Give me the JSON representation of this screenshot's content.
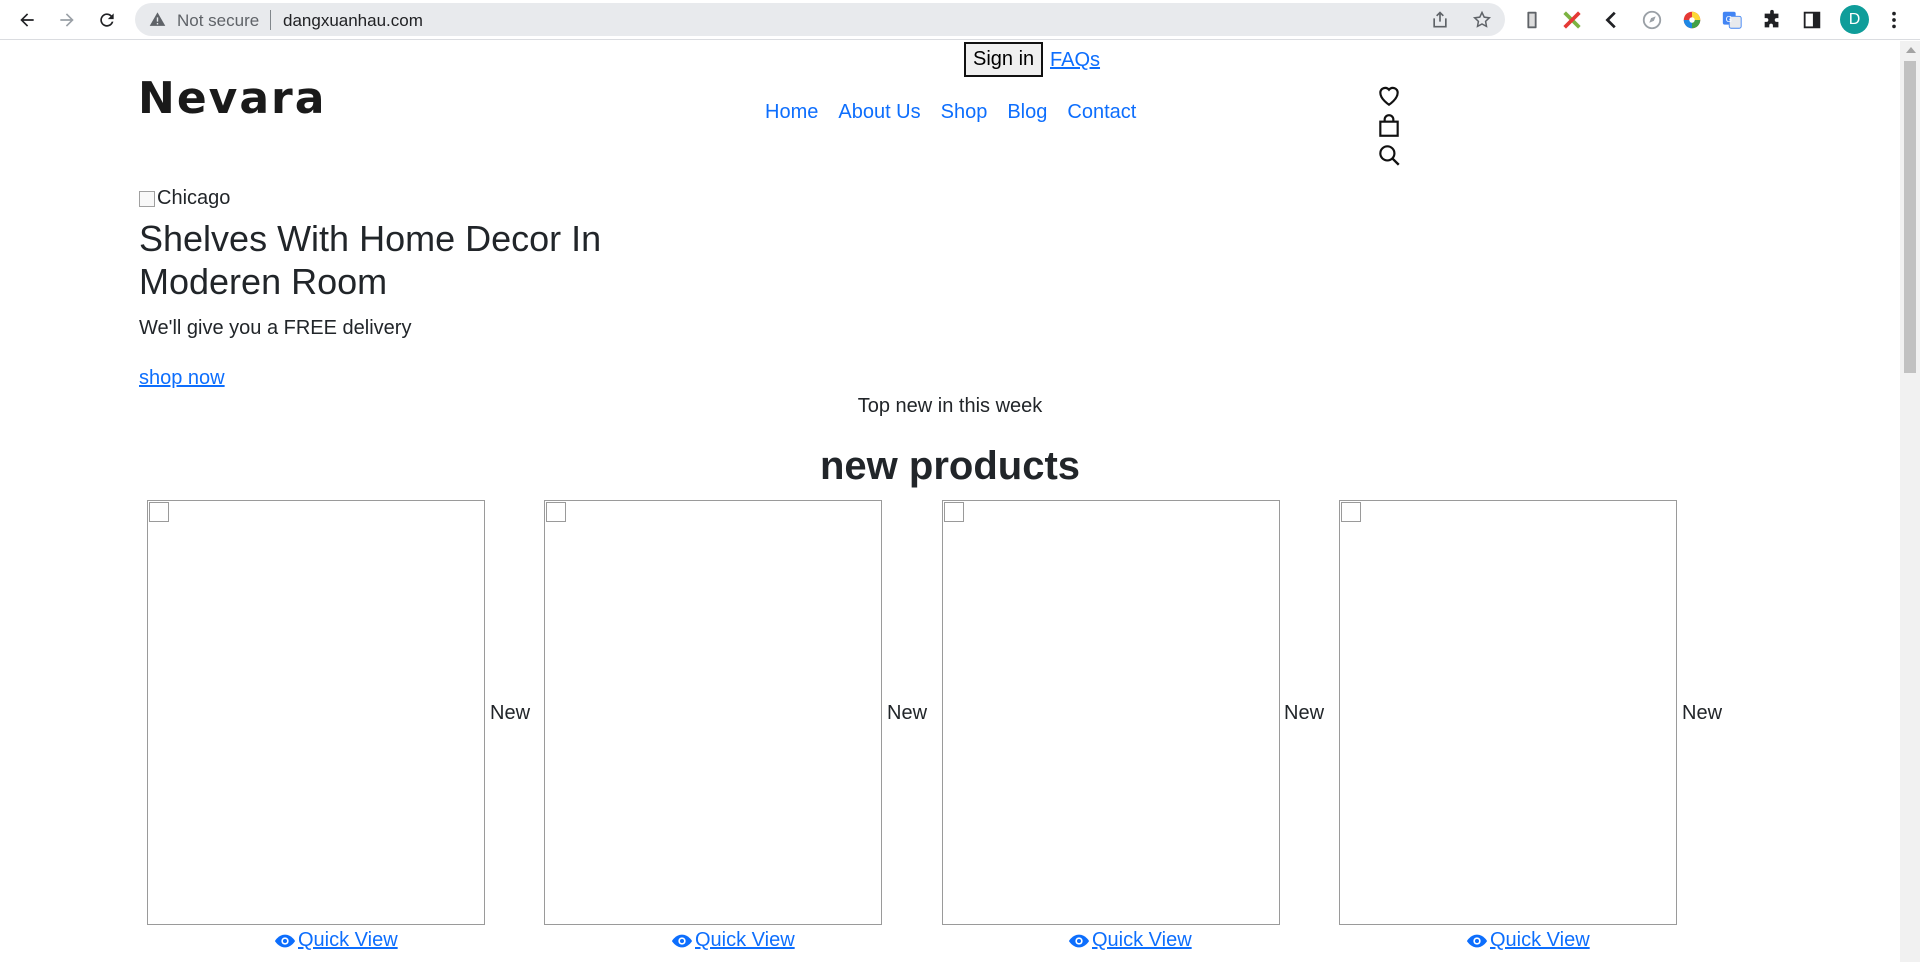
{
  "browser": {
    "security_label": "Not secure",
    "url": "dangxuanhau.com",
    "avatar_letter": "D"
  },
  "topbar": {
    "signin_label": "Sign in",
    "faq_label": "FAQs"
  },
  "brand": {
    "logo_text": "Nevara"
  },
  "nav": {
    "items": [
      {
        "label": "Home"
      },
      {
        "label": "About Us"
      },
      {
        "label": "Shop"
      },
      {
        "label": "Blog"
      },
      {
        "label": "Contact"
      }
    ]
  },
  "header_icons": [
    "heart-icon",
    "shopping-bag-icon",
    "search-icon"
  ],
  "hero": {
    "image_alt": "Chicago",
    "title": "Shelves With Home Decor In Moderen Room",
    "subtitle": "We'll give you a FREE delivery",
    "cta_label": "shop now"
  },
  "products_section": {
    "eyebrow": "Top new in this week",
    "title": "new products",
    "items": [
      {
        "badge": "New",
        "quick_view_label": "Quick View"
      },
      {
        "badge": "New",
        "quick_view_label": "Quick View"
      },
      {
        "badge": "New",
        "quick_view_label": "Quick View"
      },
      {
        "badge": "New",
        "quick_view_label": "Quick View"
      }
    ]
  },
  "colors": {
    "link": "#0d6efd",
    "text": "#212529",
    "avatar_bg": "#0f9d9a"
  }
}
